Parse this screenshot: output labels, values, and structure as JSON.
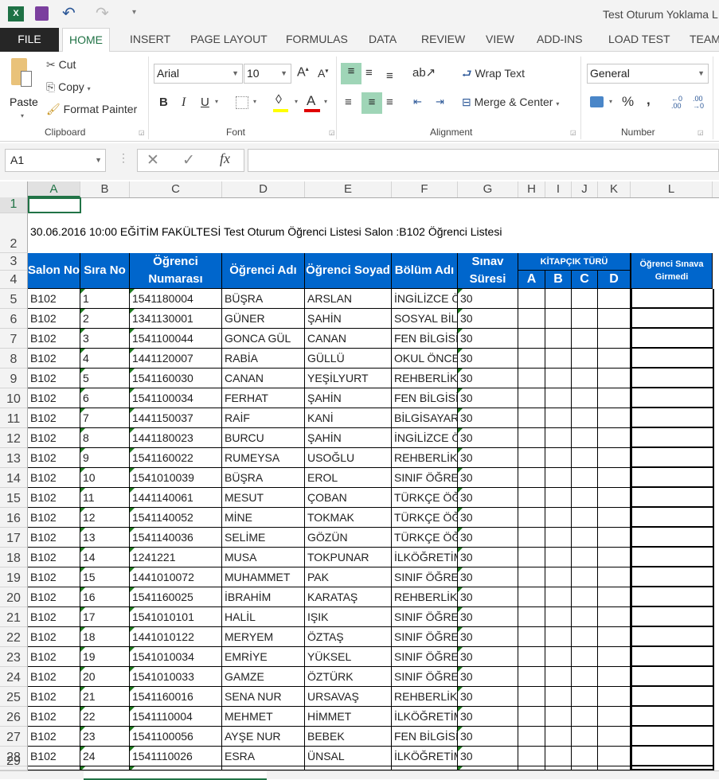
{
  "window": {
    "title": "Test Oturum Yoklama L"
  },
  "quick_access": {
    "icons": [
      "excel-logo-icon",
      "save-icon",
      "undo-icon",
      "redo-icon",
      "customize-icon"
    ]
  },
  "tabs": [
    "FILE",
    "HOME",
    "INSERT",
    "PAGE LAYOUT",
    "FORMULAS",
    "DATA",
    "REVIEW",
    "VIEW",
    "ADD-INS",
    "LOAD TEST",
    "TEAM"
  ],
  "ribbon": {
    "clipboard": {
      "paste": "Paste",
      "cut": "Cut",
      "copy": "Copy",
      "format_painter": "Format Painter",
      "label": "Clipboard"
    },
    "font": {
      "name": "Arial",
      "size": "10",
      "label": "Font",
      "bold": "B",
      "italic": "I",
      "underline": "U",
      "font_color": "A",
      "fill_color": "#ffff00",
      "text_color": "#e00000"
    },
    "alignment": {
      "wrap": "Wrap Text",
      "merge": "Merge & Center",
      "label": "Alignment"
    },
    "number": {
      "format": "General",
      "percent": "%",
      "comma": ",",
      "label": "Number"
    }
  },
  "formula_bar": {
    "name_box": "A1",
    "cancel": "✕",
    "enter": "✓",
    "fx": "fx",
    "value": ""
  },
  "columns": [
    "A",
    "B",
    "C",
    "D",
    "E",
    "F",
    "G",
    "H",
    "I",
    "J",
    "K",
    "L"
  ],
  "sheet": {
    "title_row": "30.06.2016 10:00 EĞİTİM FAKÜLTESİ Test Oturum  Öğrenci Listesi Salon :B102 Öğrenci Listesi",
    "headers": {
      "salon": "Salon No",
      "sira": "Sıra No",
      "numara": "Öğrenci Numarası",
      "adi": "Öğrenci Adı",
      "soyad": "Öğrenci Soyad",
      "bolum": "Bölüm Adı",
      "sure": "Sınav Süresi",
      "kitapcik": "KİTAPÇIK TÜRÜ",
      "a": "A",
      "b": "B",
      "c": "C",
      "d": "D",
      "girmedi": "Öğrenci Sınava Girmedi"
    },
    "header_color": "#0066cc",
    "rows": [
      [
        "B102",
        "1",
        "1541180004",
        "BÜŞRA",
        "ARSLAN",
        "İNGİLİZCE ÖĞ",
        "30"
      ],
      [
        "B102",
        "2",
        "1341130001",
        "GÜNER",
        "ŞAHİN",
        "SOSYAL BİLG",
        "30"
      ],
      [
        "B102",
        "3",
        "1541100044",
        "GONCA GÜL",
        "CANAN",
        "FEN BİLGİSİ",
        "30"
      ],
      [
        "B102",
        "4",
        "1441120007",
        "RABİA",
        "GÜLLÜ",
        "OKUL ÖNCESİ",
        "30"
      ],
      [
        "B102",
        "5",
        "1541160030",
        "CANAN",
        "YEŞİLYURT",
        "REHBERLİK V",
        "30"
      ],
      [
        "B102",
        "6",
        "1541100034",
        "FERHAT",
        "ŞAHİN",
        "FEN BİLGİSİ",
        "30"
      ],
      [
        "B102",
        "7",
        "1441150037",
        "RAİF",
        "KANİ",
        "BİLGİSAYAR",
        "30"
      ],
      [
        "B102",
        "8",
        "1441180023",
        "BURCU",
        "ŞAHİN",
        "İNGİLİZCE ÖĞ",
        "30"
      ],
      [
        "B102",
        "9",
        "1541160022",
        "RUMEYSA",
        "USOĞLU",
        "REHBERLİK V",
        "30"
      ],
      [
        "B102",
        "10",
        "1541010039",
        "BÜŞRA",
        "EROL",
        "SINIF ÖĞRET",
        "30"
      ],
      [
        "B102",
        "11",
        "1441140061",
        "MESUT",
        "ÇOBAN",
        "TÜRKÇE ÖĞR",
        "30"
      ],
      [
        "B102",
        "12",
        "1541140052",
        "MİNE",
        "TOKMAK",
        "TÜRKÇE ÖĞR",
        "30"
      ],
      [
        "B102",
        "13",
        "1541140036",
        "SELİME",
        "GÖZÜN",
        "TÜRKÇE ÖĞR",
        "30"
      ],
      [
        "B102",
        "14",
        "1241221",
        "MUSA",
        "TOKPUNAR",
        "İLKÖĞRETİM",
        "30"
      ],
      [
        "B102",
        "15",
        "1441010072",
        "MUHAMMET",
        "PAK",
        "SINIF ÖĞRET",
        "30"
      ],
      [
        "B102",
        "16",
        "1541160025",
        "İBRAHİM",
        "KARATAŞ",
        "REHBERLİK V",
        "30"
      ],
      [
        "B102",
        "17",
        "1541010101",
        "HALİL",
        "IŞIK",
        "SINIF ÖĞRET",
        "30"
      ],
      [
        "B102",
        "18",
        "1441010122",
        "MERYEM",
        "ÖZTAŞ",
        "SINIF ÖĞRET",
        "30"
      ],
      [
        "B102",
        "19",
        "1541010034",
        "EMRİYE",
        "YÜKSEL",
        "SINIF ÖĞRET",
        "30"
      ],
      [
        "B102",
        "20",
        "1541010033",
        "GAMZE",
        "ÖZTÜRK",
        "SINIF ÖĞRET",
        "30"
      ],
      [
        "B102",
        "21",
        "1541160016",
        "SENA NUR",
        "URSAVAŞ",
        "REHBERLİK V",
        "30"
      ],
      [
        "B102",
        "22",
        "1541110004",
        "MEHMET",
        "HİMMET",
        "İLKÖĞRETİM",
        "30"
      ],
      [
        "B102",
        "23",
        "1541100056",
        "AYŞE NUR",
        "BEBEK",
        "FEN BİLGİSİ",
        "30"
      ],
      [
        "B102",
        "24",
        "1541110026",
        "ESRA",
        "ÜNSAL",
        "İLKÖĞRETİM",
        "30"
      ]
    ]
  }
}
